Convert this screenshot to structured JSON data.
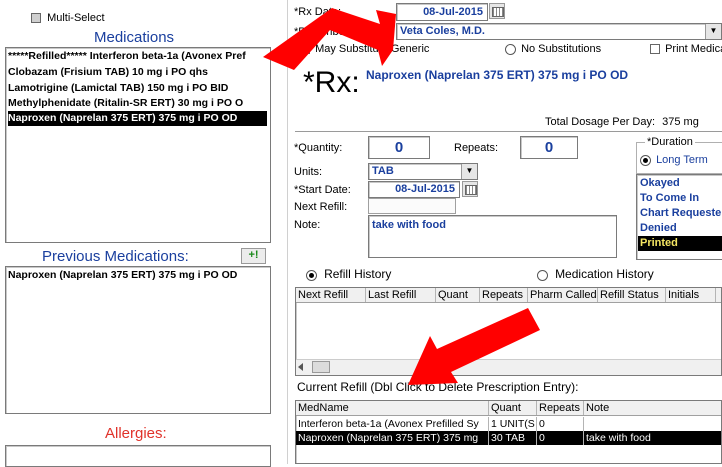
{
  "left": {
    "multi_select": "Multi-Select",
    "medications_title": "Medications",
    "medications": [
      "*****Refilled*****  Interferon beta-1a (Avonex Pref",
      "Clobazam (Frisium TAB) 10  mg   i PO  qhs",
      "Lamotrigine (Lamictal TAB) 150  mg   i PO  BID",
      "Methylphenidate (Ritalin-SR ERT) 30  mg   i PO  O",
      "Naproxen (Naprelan 375 ERT) 375  mg   i PO  OD"
    ],
    "selected_medication_index": 4,
    "previous_title": "Previous Medications:",
    "previous_button": "+!",
    "previous_medications": [
      "Naproxen (Naprelan 375 ERT) 375  mg   i PO  OD"
    ],
    "allergies_title": "Allergies:"
  },
  "rx": {
    "date_label": "*Rx Date:",
    "date_value": "08-Jul-2015",
    "prescriber_label": "*Prescriber:",
    "prescriber_value": "Veta  Coles, M.D.",
    "may_substitute": "May Substitute Generic",
    "no_substitutions": "No Substitutions",
    "print_medication": "Print Medica",
    "rx_symbol": "*Rx:",
    "drug_text": "Naproxen (Naprelan 375 ERT) 375  mg   i PO  OD",
    "total_dosage_label": "Total Dosage Per Day:",
    "total_dosage_value": "375 mg",
    "quantity_label": "*Quantity:",
    "quantity_value": "0",
    "repeats_label": "Repeats:",
    "repeats_value": "0",
    "units_label": "Units:",
    "units_value": "TAB",
    "start_date_label": "*Start Date:",
    "start_date_value": "08-Jul-2015",
    "next_refill_label": "Next Refill:",
    "next_refill_value": "",
    "note_label": "Note:",
    "note_value": "take with food"
  },
  "duration": {
    "title": "*Duration",
    "long_term": "Long Term",
    "statuses": [
      "Okayed",
      "To Come In",
      "Chart Requeste",
      "Denied",
      "Printed"
    ],
    "selected_status_index": 4
  },
  "history": {
    "refill_history": "Refill History",
    "medication_history": "Medication History",
    "columns": [
      "Next Refill",
      "Last Refill",
      "Quant",
      "Repeats",
      "Pharm Called",
      "Refill Status",
      "Initials"
    ]
  },
  "current_refill": {
    "title": "Current Refill (Dbl Click to Delete Prescription Entry):",
    "columns": [
      "MedName",
      "Quant",
      "Repeats",
      "Note"
    ],
    "rows": [
      {
        "med": "Interferon beta-1a (Avonex Prefilled Sy",
        "quant": "1 UNIT(S",
        "repeats": "0",
        "note": ""
      },
      {
        "med": "Naproxen (Naprelan 375 ERT) 375  mg",
        "quant": "30 TAB",
        "repeats": "0",
        "note": "take with food"
      }
    ],
    "selected_row_index": 1
  },
  "colors": {
    "accent_blue": "#1a3f9e",
    "allergy_red": "#e0322a",
    "arrow_red": "#ff0000",
    "status_highlight": "#f5e663"
  }
}
